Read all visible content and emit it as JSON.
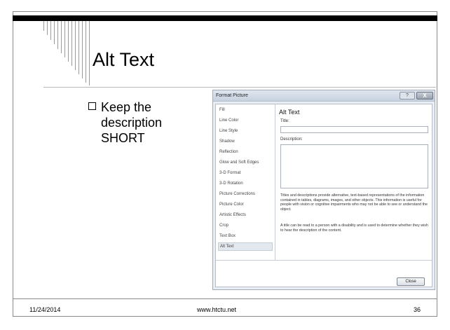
{
  "slide": {
    "title": "Alt Text",
    "bullet": "Keep the description SHORT",
    "footer": {
      "date": "11/24/2014",
      "url": "www.htctu.net",
      "page": "36"
    }
  },
  "dialog": {
    "title": "Format Picture",
    "help_icon": "?",
    "close_icon": "X",
    "menu_items": [
      "Fill",
      "Line Color",
      "Line Style",
      "Shadow",
      "Reflection",
      "Glow and Soft Edges",
      "3-D Format",
      "3-D Rotation",
      "Picture Corrections",
      "Picture Color",
      "Artistic Effects",
      "Crop",
      "Text Box",
      "Alt Text"
    ],
    "selected_item": "Alt Text",
    "pane": {
      "heading": "Alt Text",
      "title_label": "Title:",
      "title_value": "",
      "description_label": "Description:",
      "description_value": "",
      "help_text_1": "Titles and descriptions provide alternative, text-based representations of the information contained in tables, diagrams, images, and other objects. This information is useful for people with vision or cognitive impairments who may not be able to see or understand the object.",
      "help_text_2": "A title can be read to a person with a disability and is used to determine whether they wish to hear the description of the content."
    },
    "close_button": "Close"
  }
}
